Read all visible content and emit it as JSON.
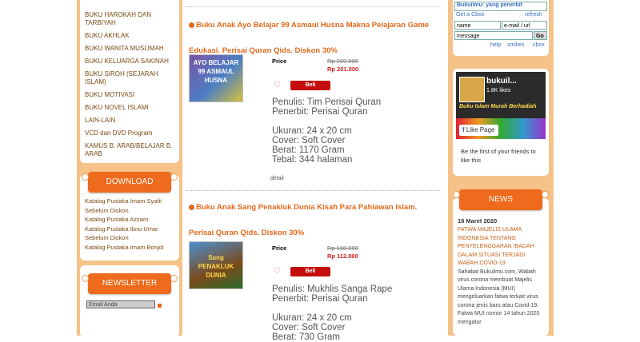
{
  "left_sidebar": {
    "categories": [
      "BUKU HAROKAH DAN TARBIYAH",
      "BUKU AKHLAK",
      "BUKU WANITA MUSLIMAH",
      "BUKU KELUARGA SAKINAH",
      "BUKU SIROH (SEJARAH ISLAM)",
      "BUKU MOTIVASI",
      "BUKU NOVEL ISLAMI",
      "LAIN-LAIN",
      "VCD dan DVD Program",
      "KAMUS B. ARAB/BELAJAR B. ARAB"
    ],
    "download_title": "DOWNLOAD",
    "downloads": [
      "Katalog Pustaka Imam Syafii Sebelum Diskon",
      "Katalog Pustaka Azzam",
      "Katalog Pustaka Ibnu Umar Sebelum Diskon",
      "Katalog Pustaka Imam Bonjol"
    ],
    "newsletter_title": "NEWSLETTER",
    "newsletter_placeholder": "Email Anda"
  },
  "products": [
    {
      "title": "Buku Anak Ayo Belajar 99 Asmaul Husna Makna Pelajaran Game Edukasi. Perisai Quran Qids. Diskon 30%",
      "price_label": "Price",
      "old_price": "Rp 289.000",
      "new_price": "Rp 201.000",
      "buy_label": "Beli",
      "cover_text": "AYO BELAJAR 99 ASMAUL HUSNA",
      "specs": [
        "Penulis: Tim Perisai Quran",
        "Penerbit: Perisai Quran",
        "",
        "Ukuran: 24 x 20 cm",
        "Cover: Soft Cover",
        "Berat: 1170 Gram",
        "Tebal: 344 halaman"
      ],
      "detail_label": "detail"
    },
    {
      "title": "Buku Anak Sang Penakluk Dunia Kisah Para Pahlawan Islam. Perisai Quran Qids. Diskon 30%",
      "price_label": "Price",
      "old_price": "Rp 160.000",
      "new_price": "Rp 112.000",
      "buy_label": "Beli",
      "cover_text": "Sang PENAKLUK DUNIA",
      "specs": [
        "Penulis: Mukhlis Sanga Rape",
        "Penerbit: Perisai Quran",
        "",
        "Ukuran: 24 x 20 cm",
        "Cover: Soft Cover",
        "Berat: 730 Gram"
      ]
    }
  ],
  "shoutbox": {
    "top_text": "Bukuilmu: yang penerbit",
    "get_link": "Get a Cbox",
    "refresh_link": "refresh",
    "name_placeholder": "name",
    "url_placeholder": "e-mail / url",
    "message_placeholder": "message",
    "go_label": "Go",
    "help_link": "help",
    "smilies_link": "smilies",
    "cbox_link": "cbox"
  },
  "facebook": {
    "page_name": "bukuil...",
    "likes": "1.8K likes",
    "cover_caption": "Buku Islam Murah Berhadiah",
    "like_label": "Like Page",
    "friends_text": "Be the first of your friends to like this"
  },
  "news": {
    "title": "NEWS",
    "date": "18 Maret 2020",
    "headline": "FATWA MAJELIS ULAMA INDONESIA Tentang PENYELENGGARAN IBADAH DALAM SITUASI TERJADI WABAH COVID-19",
    "body": "Sahabat Bukuilmu.com, Wabah virus corona membuat Majelis Ulama Indonesia (MUI) mengeluarkan fatwa terkait virus corona jenis baru atau Covid-19. Fatwa MUI nomor 14 tahun 2020 mengatur"
  },
  "colors": {
    "accent_orange": "#ee6a1c",
    "sidebar_bg": "#f5c28a",
    "price_red": "#d01e1e",
    "buy_red": "#c40e0e",
    "link_blue": "#3a6ec0"
  }
}
